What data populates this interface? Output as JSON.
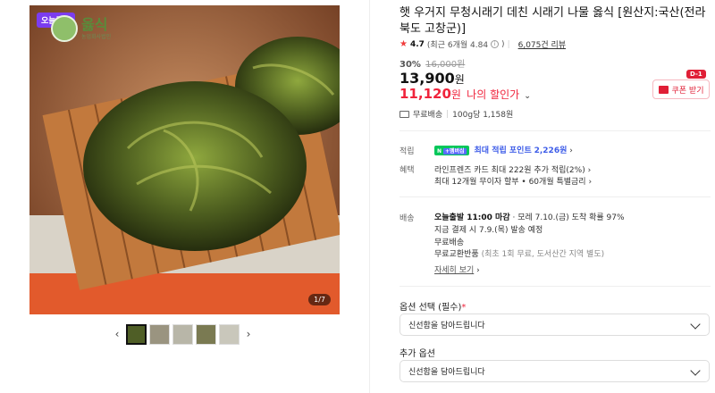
{
  "gallery": {
    "badge": "오늘끝딜",
    "brand_name": "옳식",
    "brand_sub": "농업회사법인",
    "counter": "1/7",
    "prev": "‹",
    "next": "›"
  },
  "product": {
    "title": "햇 우거지 무청시래기 데친 시래기 나물 옳식 [원산지:국산(전라북도 고창군)]",
    "rating": {
      "score": "4.7",
      "detail": "(최근 6개월 4.84",
      "detail_close": ")",
      "reviews": "6,075건 리뷰"
    },
    "discount_rate": "30%",
    "original_price": "16,000원",
    "price": "13,900",
    "price_unit": "원",
    "sale_price": "11,120",
    "sale_unit": "원",
    "sale_label": "나의 할인가",
    "coupon_badge": "D-1",
    "coupon_label": "쿠폰 받기",
    "shipping": {
      "free": "무료배송",
      "unit_price": "100g당 1,158원"
    }
  },
  "benefits": {
    "points_label": "적립",
    "npay": "N",
    "npay_plus": "+멤버십",
    "points_text": "최대 적립 포인트",
    "points_value": "2,226원",
    "points_chev": "›",
    "perks_label": "혜택",
    "perk1": "라인프렌즈 카드 최대 222원 추가 적립(2%)",
    "perk2": "최대 12개월 무이자 할부 • 60개월 특별금리",
    "chev": "›"
  },
  "delivery": {
    "label": "배송",
    "cutoff": "오늘출발 11:00 마감",
    "arrival": " · 모레 7.10.(금) 도착 확률 97%",
    "pay_now": "지금 결제 시 7.9.(목) 발송 예정",
    "free": "무료배송",
    "exchange": "무료교환반품",
    "exchange_note": "(최초 1회 무료, 도서산간 지역 별도)",
    "more": "자세히 보기",
    "more_chev": "›"
  },
  "options": {
    "required_label": "옵션 선택 (필수)",
    "required_mark": "*",
    "required_value": "신선함을 담아드립니다",
    "extra_label": "추가 옵션",
    "extra_value": "신선함을 담아드립니다"
  },
  "colors": {
    "sale_red": "#f0243c",
    "points_blue": "#3d5ce8",
    "npay_green": "#03c75a",
    "badge_purple": "#7b3cf0"
  }
}
